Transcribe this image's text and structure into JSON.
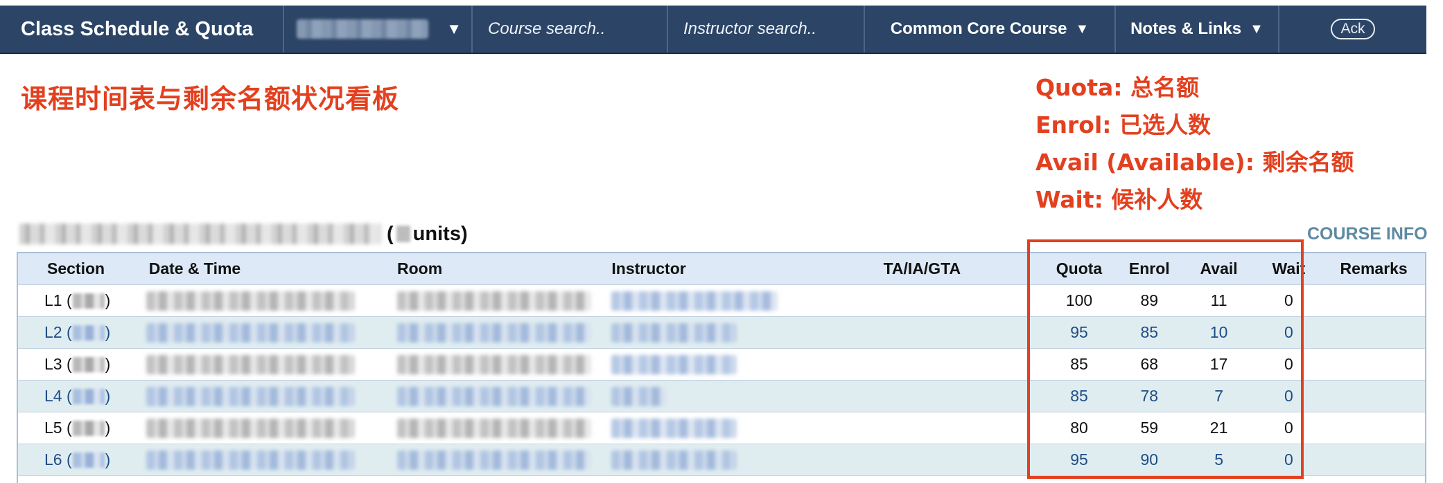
{
  "navbar": {
    "title": "Class Schedule & Quota",
    "course_search_placeholder": "Course search..",
    "instructor_search_placeholder": "Instructor search..",
    "common_core_label": "Common Core Course",
    "notes_links_label": "Notes & Links",
    "ack_label": "Ack",
    "dropdown_icon": "triangle-down-icon"
  },
  "annotation": {
    "title": "课程时间表与剩余名额状况看板",
    "legend": [
      "Quota: 总名额",
      "Enrol: 已选人数",
      "Avail (Available): 剩余名额",
      "Wait: 候补人数"
    ],
    "highlight_color": "#e3401f"
  },
  "course": {
    "units_label": "units)",
    "units_open": "(",
    "info_link": "COURSE INFO"
  },
  "table": {
    "headers": {
      "section": "Section",
      "datetime": "Date & Time",
      "room": "Room",
      "instructor": "Instructor",
      "ta": "TA/IA/GTA",
      "quota": "Quota",
      "enrol": "Enrol",
      "avail": "Avail",
      "wait": "Wait",
      "remarks": "Remarks"
    },
    "rows": [
      {
        "section": "L1",
        "quota": "100",
        "enrol": "89",
        "avail": "11",
        "wait": "0"
      },
      {
        "section": "L2",
        "quota": "95",
        "enrol": "85",
        "avail": "10",
        "wait": "0"
      },
      {
        "section": "L3",
        "quota": "85",
        "enrol": "68",
        "avail": "17",
        "wait": "0"
      },
      {
        "section": "L4",
        "quota": "85",
        "enrol": "78",
        "avail": "7",
        "wait": "0"
      },
      {
        "section": "L5",
        "quota": "80",
        "enrol": "59",
        "avail": "21",
        "wait": "0"
      },
      {
        "section": "L6",
        "quota": "95",
        "enrol": "90",
        "avail": "5",
        "wait": "0"
      }
    ]
  },
  "colors": {
    "navbar_bg": "#2c4566",
    "annotation_red": "#e3401f",
    "link_blue": "#1d4d86",
    "course_info": "#5e8aa3",
    "header_bg": "#dde9f6",
    "alt_row_bg": "#e0edf0"
  }
}
